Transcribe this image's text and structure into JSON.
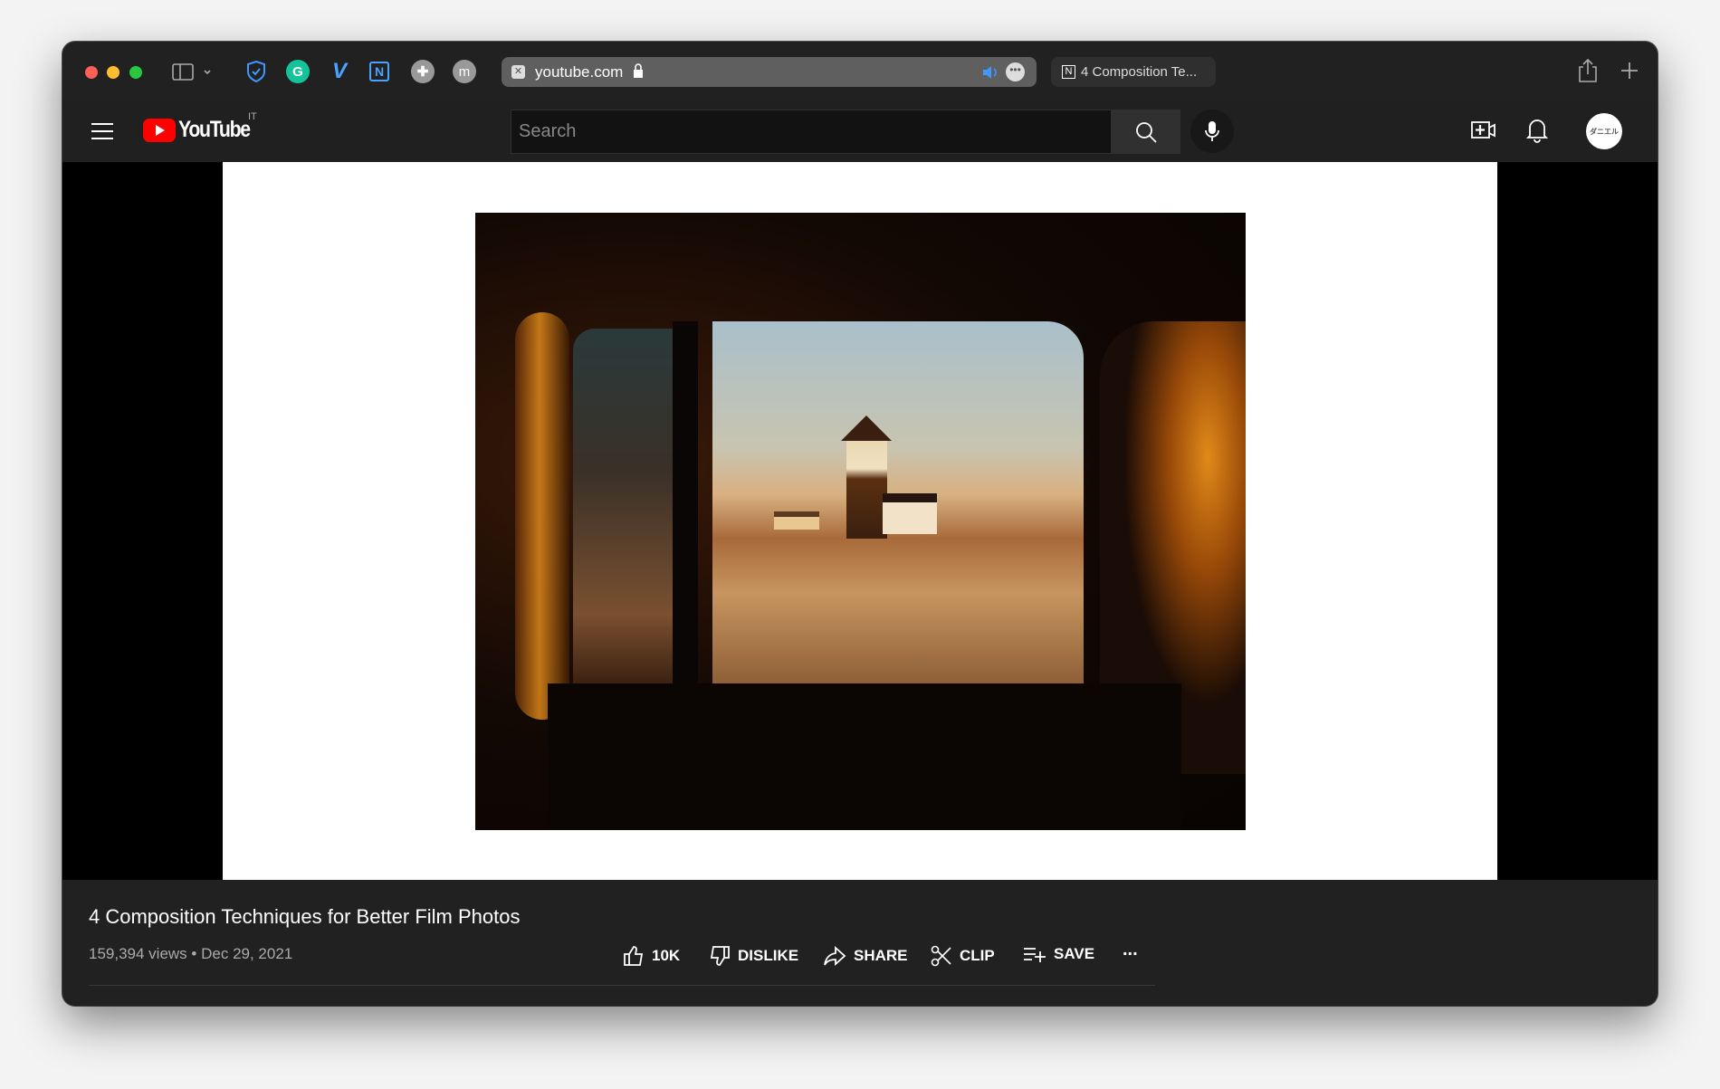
{
  "browser": {
    "url": "youtube.com",
    "tab2_title": "4 Composition Te...",
    "ext_m": "m",
    "colors": {
      "close": "#fe5f57",
      "min": "#febc2e",
      "max": "#28c840"
    }
  },
  "youtube": {
    "logo": "YouTube",
    "region": "IT",
    "search_placeholder": "Search",
    "avatar_text": "ダニエル"
  },
  "video": {
    "title": "4 Composition Techniques for Better Film Photos",
    "views": "159,394 views",
    "date": "Dec 29, 2021",
    "separator": "•",
    "actions": {
      "like": "10K",
      "dislike": "DISLIKE",
      "share": "SHARE",
      "clip": "CLIP",
      "save": "SAVE",
      "more": "..."
    }
  }
}
